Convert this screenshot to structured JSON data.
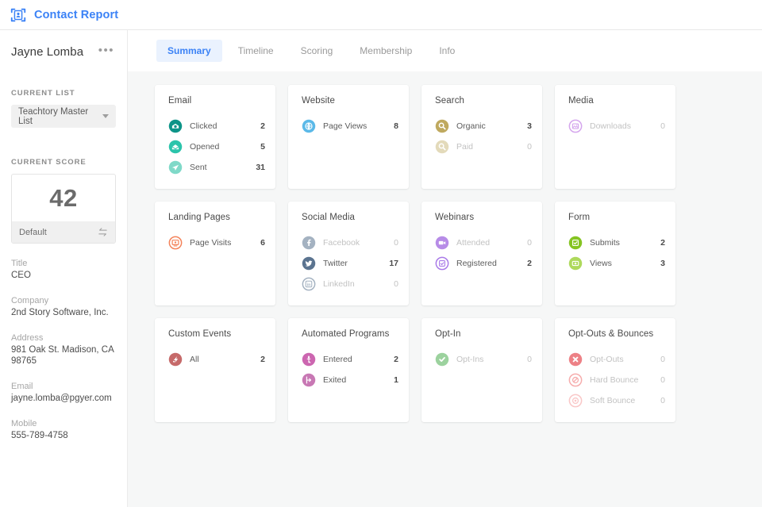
{
  "header": {
    "icon": "contact-card-icon",
    "title": "Contact Report",
    "accent": "#3b82f6"
  },
  "sidebar": {
    "contact_name": "Jayne Lomba",
    "more_menu": "•••",
    "current_list_label": "CURRENT LIST",
    "current_list_value": "Teachtory Master List",
    "current_score_label": "CURRENT SCORE",
    "score_value": "42",
    "score_model": "Default",
    "score_swap_icon": "swap-arrows-icon",
    "fields": [
      {
        "label": "Title",
        "value": "CEO"
      },
      {
        "label": "Company",
        "value": "2nd Story Software, Inc."
      },
      {
        "label": "Address",
        "value": "981 Oak St. Madison, CA 98765"
      },
      {
        "label": "Email",
        "value": "jayne.lomba@pgyer.com"
      },
      {
        "label": "Mobile",
        "value": "555-789-4758"
      }
    ]
  },
  "tabs": [
    {
      "label": "Summary",
      "active": true
    },
    {
      "label": "Timeline",
      "active": false
    },
    {
      "label": "Scoring",
      "active": false
    },
    {
      "label": "Membership",
      "active": false
    },
    {
      "label": "Info",
      "active": false
    }
  ],
  "cards": [
    [
      {
        "title": "Email",
        "metrics": [
          {
            "icon": "email-clicked-icon",
            "label": "Clicked",
            "value": "2",
            "dim": false,
            "color": "#0d9488"
          },
          {
            "icon": "email-opened-icon",
            "label": "Opened",
            "value": "5",
            "dim": false,
            "color": "#2bc4ab"
          },
          {
            "icon": "email-sent-icon",
            "label": "Sent",
            "value": "31",
            "dim": false,
            "color": "#7fd9c8"
          }
        ]
      },
      {
        "title": "Website",
        "metrics": [
          {
            "icon": "page-views-icon",
            "label": "Page Views",
            "value": "8",
            "dim": false,
            "color": "#5bb9e8"
          }
        ]
      },
      {
        "title": "Search",
        "metrics": [
          {
            "icon": "search-organic-icon",
            "label": "Organic",
            "value": "3",
            "dim": false,
            "color": "#bfa95f"
          },
          {
            "icon": "search-paid-icon",
            "label": "Paid",
            "value": "0",
            "dim": true,
            "color": "#cdbd83"
          }
        ]
      },
      {
        "title": "Media",
        "metrics": [
          {
            "icon": "media-downloads-icon",
            "label": "Downloads",
            "value": "0",
            "dim": true,
            "color": "#b35ee0"
          }
        ]
      }
    ],
    [
      {
        "title": "Landing Pages",
        "metrics": [
          {
            "icon": "page-visits-icon",
            "label": "Page Visits",
            "value": "6",
            "dim": false,
            "color": "#f4835a"
          }
        ]
      },
      {
        "title": "Social Media",
        "metrics": [
          {
            "icon": "facebook-icon",
            "label": "Facebook",
            "value": "0",
            "dim": true,
            "color": "#5b7490"
          },
          {
            "icon": "twitter-icon",
            "label": "Twitter",
            "value": "17",
            "dim": false,
            "color": "#5b7490"
          },
          {
            "icon": "linkedin-icon",
            "label": "LinkedIn",
            "value": "0",
            "dim": true,
            "color": "#5b7490"
          }
        ]
      },
      {
        "title": "Webinars",
        "metrics": [
          {
            "icon": "webinar-attended-icon",
            "label": "Attended",
            "value": "0",
            "dim": true,
            "color": "#7d2fd4"
          },
          {
            "icon": "webinar-registered-icon",
            "label": "Registered",
            "value": "2",
            "dim": false,
            "color": "#a97ae8"
          }
        ]
      },
      {
        "title": "Form",
        "metrics": [
          {
            "icon": "form-submits-icon",
            "label": "Submits",
            "value": "2",
            "dim": false,
            "color": "#85c422"
          },
          {
            "icon": "form-views-icon",
            "label": "Views",
            "value": "3",
            "dim": false,
            "color": "#aed95c"
          }
        ]
      }
    ],
    [
      {
        "title": "Custom Events",
        "metrics": [
          {
            "icon": "custom-events-all-icon",
            "label": "All",
            "value": "2",
            "dim": false,
            "color": "#c66a6a"
          }
        ]
      },
      {
        "title": "Automated Programs",
        "metrics": [
          {
            "icon": "program-entered-icon",
            "label": "Entered",
            "value": "2",
            "dim": false,
            "color": "#cc66b0"
          },
          {
            "icon": "program-exited-icon",
            "label": "Exited",
            "value": "1",
            "dim": false,
            "color": "#c878b4"
          }
        ]
      },
      {
        "title": "Opt-In",
        "metrics": [
          {
            "icon": "opt-ins-icon",
            "label": "Opt-Ins",
            "value": "0",
            "dim": true,
            "color": "#4caf50"
          }
        ]
      },
      {
        "title": "Opt-Outs & Bounces",
        "metrics": [
          {
            "icon": "opt-outs-icon",
            "label": "Opt-Outs",
            "value": "0",
            "dim": true,
            "color": "#e01b24"
          },
          {
            "icon": "hard-bounce-icon",
            "label": "Hard Bounce",
            "value": "0",
            "dim": true,
            "color": "#f06a6a"
          },
          {
            "icon": "soft-bounce-icon",
            "label": "Soft Bounce",
            "value": "0",
            "dim": true,
            "color": "#f59a9a"
          }
        ]
      }
    ]
  ]
}
